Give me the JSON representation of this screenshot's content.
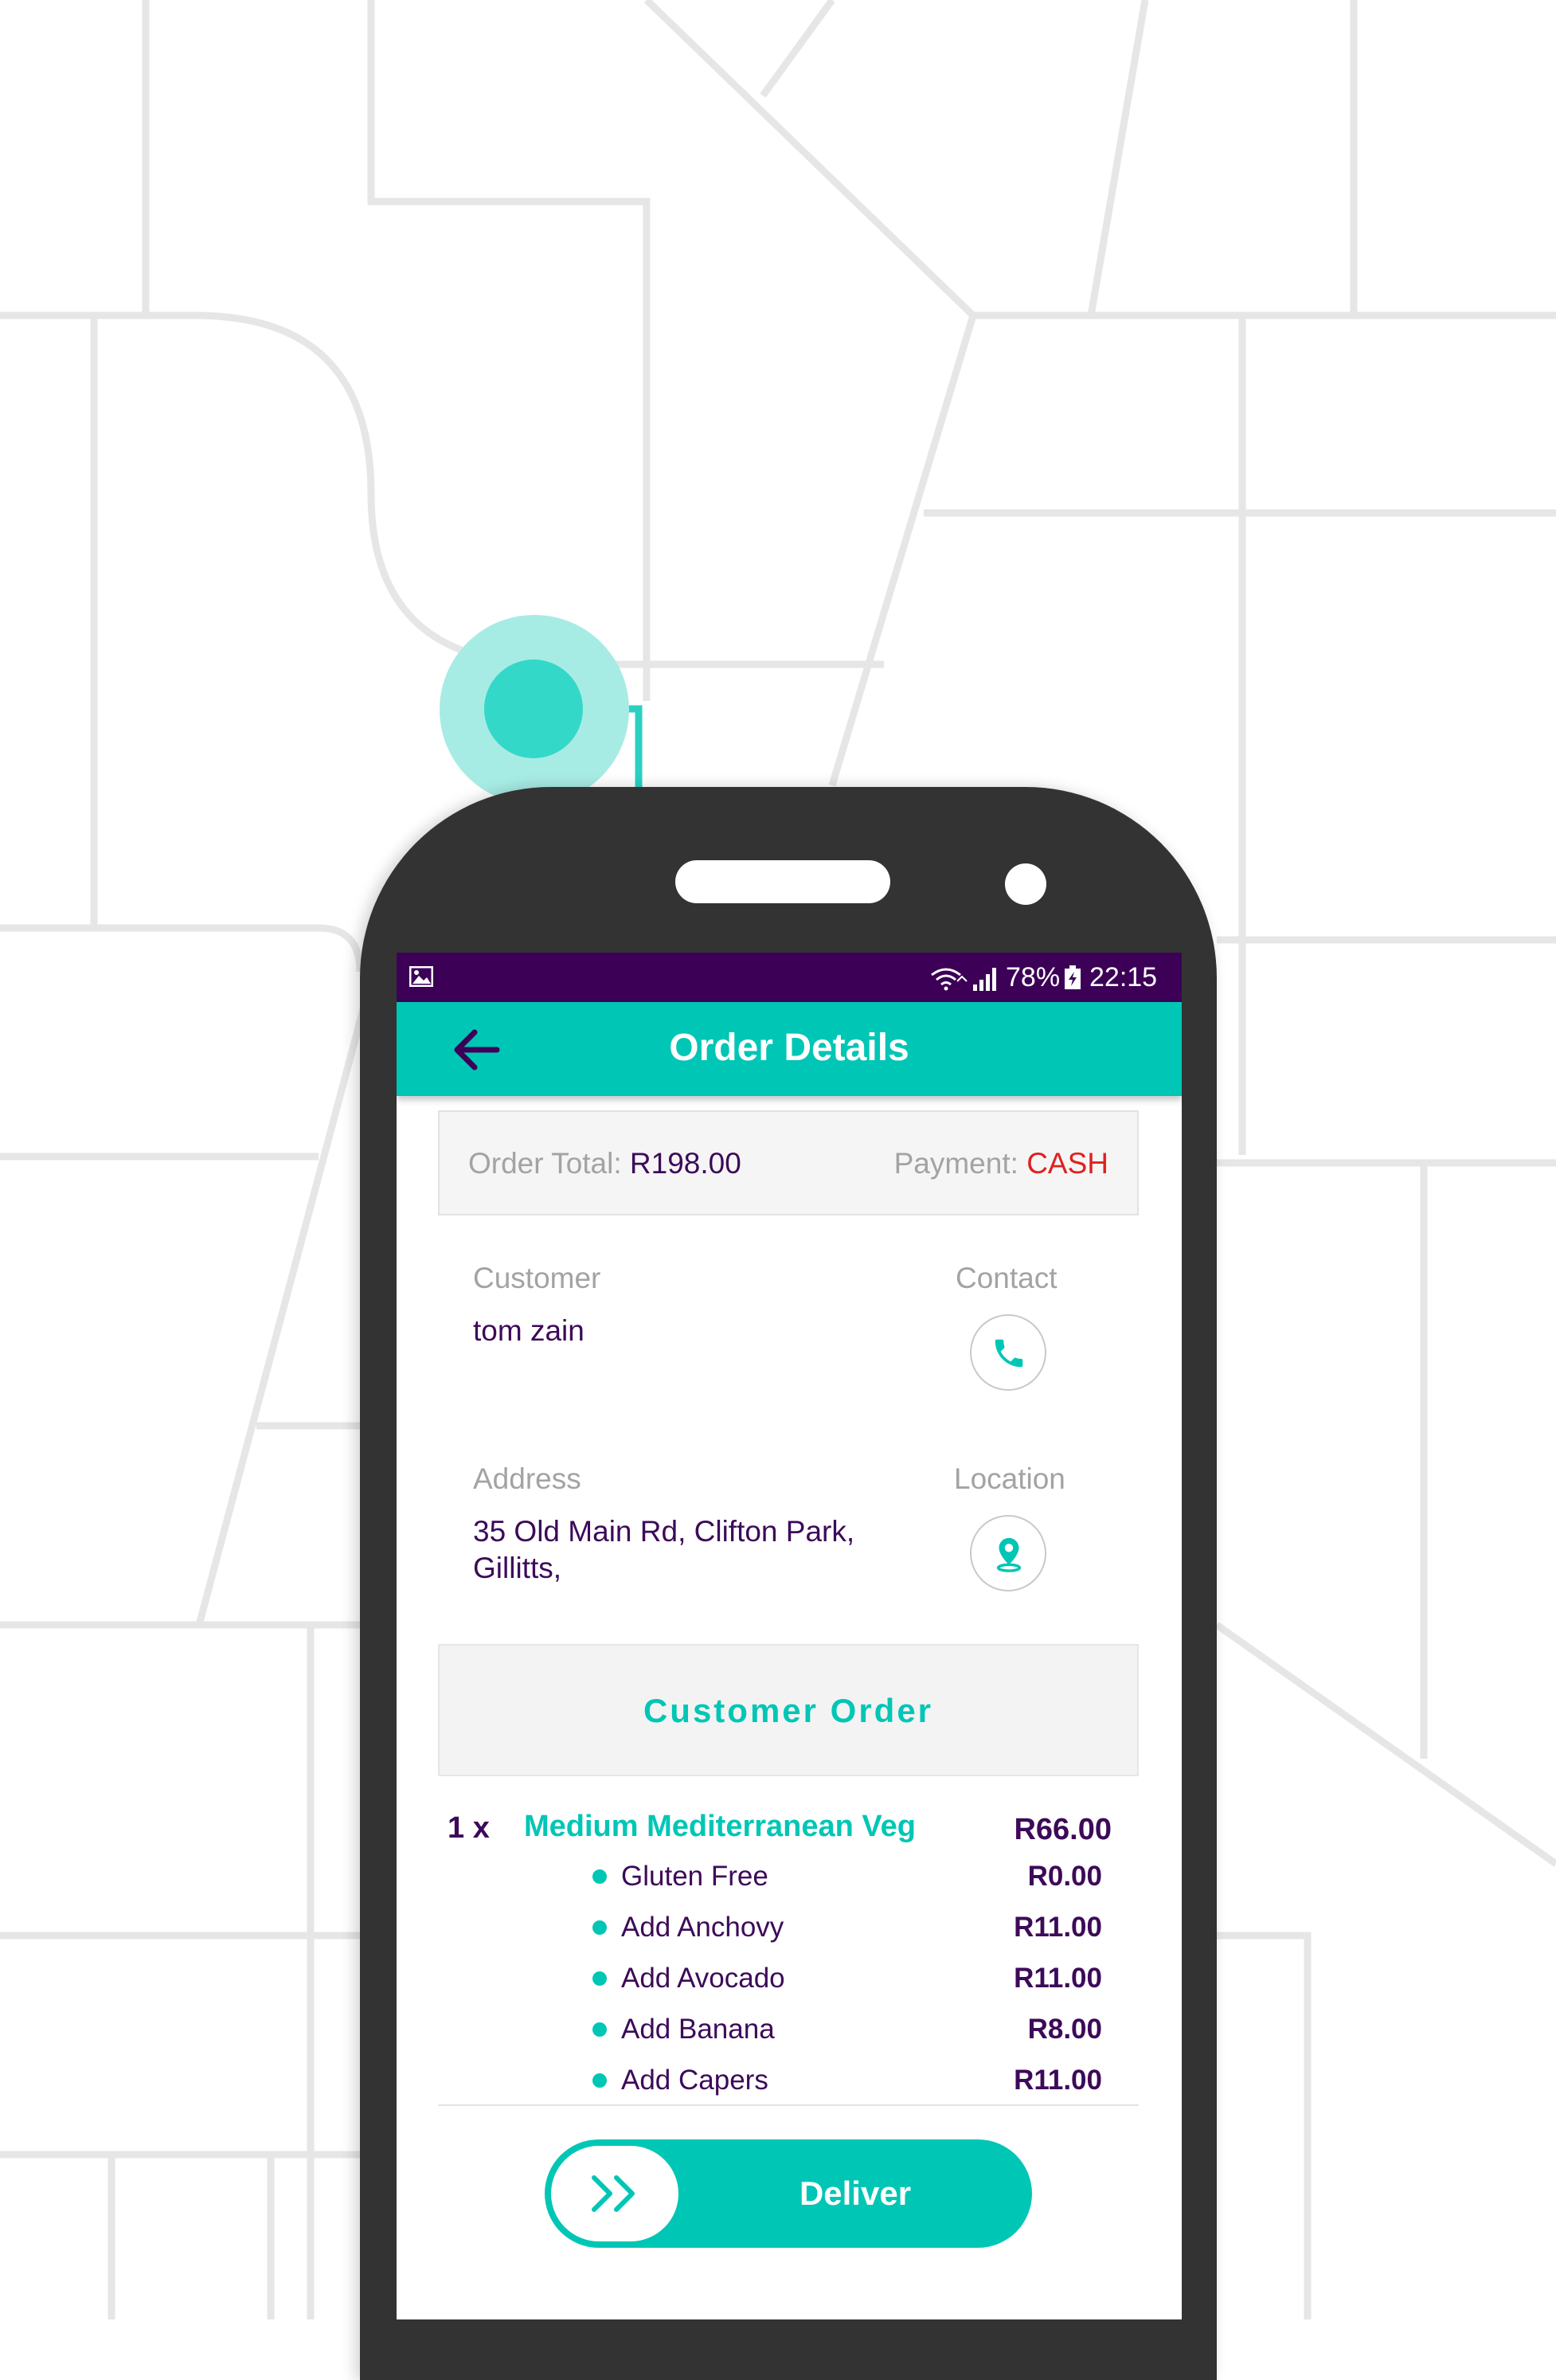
{
  "status_bar": {
    "battery_percent": "78%",
    "time": "22:15"
  },
  "app_bar": {
    "title": "Order Details"
  },
  "summary": {
    "order_total_label": "Order Total:",
    "order_total_value": "R198.00",
    "payment_label": "Payment:",
    "payment_value": "CASH"
  },
  "customer": {
    "label": "Customer",
    "name": "tom zain",
    "contact_label": "Contact",
    "address_label": "Address",
    "address_line1": "35 Old Main Rd, Clifton Park,",
    "address_line2": "Gillitts,",
    "location_label": "Location"
  },
  "order_section": {
    "title": "Customer Order"
  },
  "items": [
    {
      "qty": "1 x",
      "name": "Medium Mediterranean Veg",
      "price": "R66.00",
      "addons": [
        {
          "name": "Gluten Free",
          "price": "R0.00"
        },
        {
          "name": "Add Anchovy",
          "price": "R11.00"
        },
        {
          "name": "Add Avocado",
          "price": "R11.00"
        },
        {
          "name": "Add Banana",
          "price": "R8.00"
        },
        {
          "name": "Add Capers",
          "price": "R11.00"
        }
      ]
    }
  ],
  "deliver_button": {
    "label": "Deliver"
  },
  "icons": {
    "back": "arrow-left-icon",
    "phone": "phone-icon",
    "location": "location-pin-icon",
    "slide": "double-chevron-right-icon"
  },
  "colors": {
    "teal": "#00c6b5",
    "purple": "#3c0057",
    "cash_red": "#e02020"
  }
}
